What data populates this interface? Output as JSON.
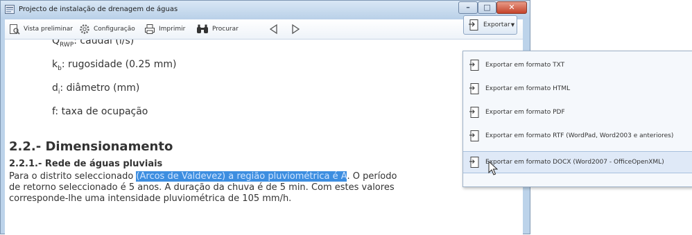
{
  "window": {
    "title": "Projecto de instalação de drenagem de águas"
  },
  "toolbar": {
    "preview": "Vista preliminar",
    "config": "Configuração",
    "print": "Imprimir",
    "search": "Procurar",
    "prev_icon": "triangle-left",
    "next_icon": "triangle-right",
    "export": "Exportar"
  },
  "content": {
    "q_label": "Q",
    "q_sub": "RWP",
    "q_desc": ": caudal (l/s)",
    "k_label": "k",
    "k_sub": "b",
    "k_desc": ": rugosidade (0.25 mm)",
    "d_label": "d",
    "d_sub": "i",
    "d_desc": ": diâmetro (mm)",
    "f_line": "f: taxa de ocupação",
    "heading": "2.2.- Dimensionamento",
    "subheading": "2.2.1.- Rede de águas pluviais",
    "para_line1_a": "Para o distrito seleccionado ",
    "para_line1_hl": "(Arcos de Valdevez) a região pluviométrica é A",
    "para_line1_b": ". O período",
    "para_line2": "de retorno seleccionado é 5 anos. A duração da chuva é de 5 min. Com estes valores",
    "para_line3": "corresponde-lhe uma intensidade pluviométrica de 105 mm/h."
  },
  "export_menu": {
    "items": [
      "Exportar em formato TXT",
      "Exportar em formato HTML",
      "Exportar em formato PDF",
      "Exportar em formato RTF (WordPad, Word2003 e anteriores)",
      "Exportar em formato DOCX (Word2007 - OfficeOpenXML)"
    ],
    "selected_index": 4
  },
  "colors": {
    "highlight": "#3d8ee0",
    "close_button": "#c4432a",
    "menu_selected": "#dfe9f7"
  }
}
